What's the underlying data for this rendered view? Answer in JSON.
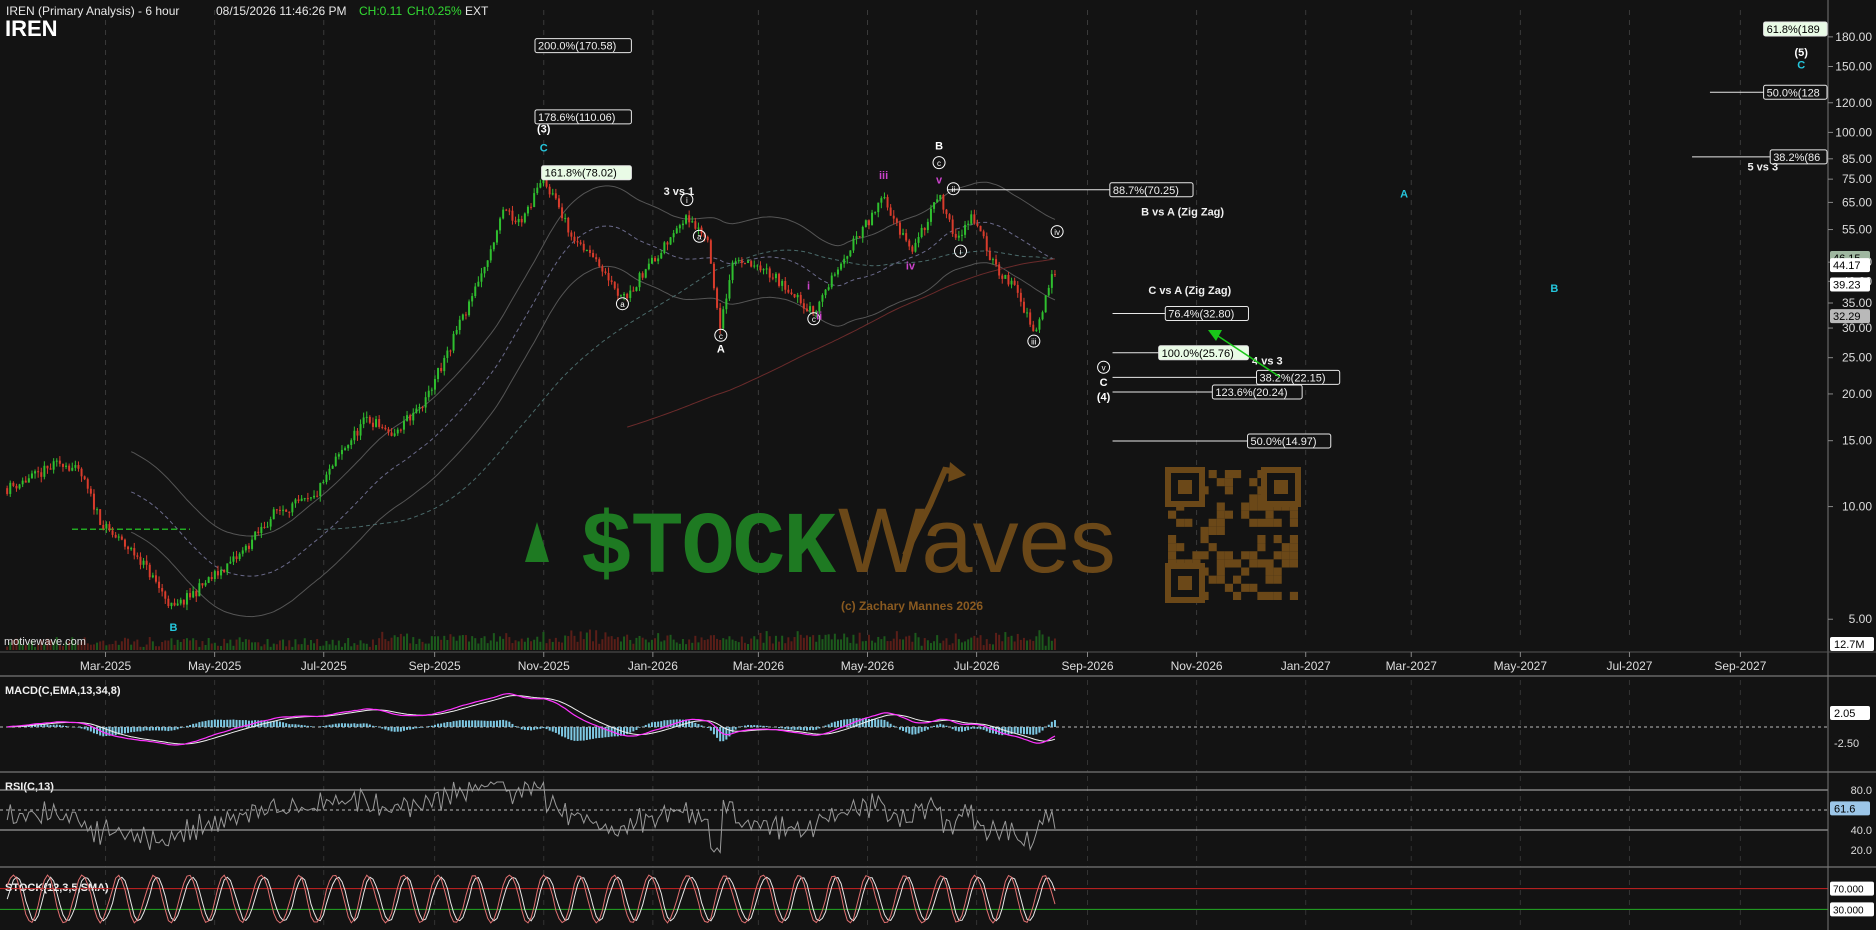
{
  "header": {
    "title": "IREN (Primary Analysis) - 6 hour",
    "timestamp": "08/15/2026 11:46:26 PM",
    "change": "CH:0.11",
    "change_pct": "CH:0.25%",
    "session": "EXT",
    "symbol": "IREN",
    "site": "motivewave.com"
  },
  "watermark": {
    "brand_left": "$TOCK",
    "brand_right": "Waves",
    "copyright": "(c) Zachary Mannes 2026"
  },
  "colors": {
    "background": "#131313",
    "candle_up": "#2fbf2f",
    "candle_down": "#d93c2c",
    "macd_line": "#ff33ff",
    "macd_signal": "#f0f0f0",
    "macd_hist": "#7ec8e3",
    "wave_cyan": "#25c6dc",
    "wave_magenta": "#cc44cc",
    "arrow_green": "#19c619",
    "watermark_green": "#1e7a22",
    "watermark_brown": "#6b4818"
  },
  "chart_data": [
    {
      "type": "candlestick",
      "title": "IREN (Primary Analysis) - 6 hour",
      "x_tick_labels": [
        "Mar-2025",
        "May-2025",
        "Jul-2025",
        "Sep-2025",
        "Nov-2025",
        "Jan-2026",
        "Mar-2026",
        "May-2026",
        "Jul-2026",
        "Sep-2026",
        "Nov-2026",
        "Jan-2027",
        "Mar-2027",
        "May-2027",
        "Jul-2027",
        "Sep-2027"
      ],
      "y_scale": "log",
      "y_tick_labels": [
        "5.00",
        "10.00",
        "15.00",
        "20.00",
        "25.00",
        "30.00",
        "35.00",
        "40.00",
        "45.00",
        "55.00",
        "65.00",
        "75.00",
        "85.00",
        "100.00",
        "120.00",
        "150.00",
        "180.00"
      ],
      "price_tags": [
        {
          "label": "46.15",
          "value": 46.15
        },
        {
          "label": "44.17",
          "value": 44.17
        },
        {
          "label": "39.23",
          "value": 39.23
        },
        {
          "label": "32.29",
          "value": 32.29
        }
      ],
      "volume_tag": "12.7M",
      "price_path": [
        {
          "x": "2025-01-05",
          "y": 11.2
        },
        {
          "x": "2025-01-20",
          "y": 12.0
        },
        {
          "x": "2025-02-05",
          "y": 13.2
        },
        {
          "x": "2025-02-15",
          "y": 12.2
        },
        {
          "x": "2025-02-28",
          "y": 8.8
        },
        {
          "x": "2025-03-20",
          "y": 7.3
        },
        {
          "x": "2025-04-08",
          "y": 5.3
        },
        {
          "x": "2025-04-25",
          "y": 6.2
        },
        {
          "x": "2025-05-15",
          "y": 7.4
        },
        {
          "x": "2025-06-05",
          "y": 9.8
        },
        {
          "x": "2025-06-25",
          "y": 10.4
        },
        {
          "x": "2025-07-10",
          "y": 13.8
        },
        {
          "x": "2025-07-25",
          "y": 17.2
        },
        {
          "x": "2025-08-08",
          "y": 15.8
        },
        {
          "x": "2025-08-25",
          "y": 18.5
        },
        {
          "x": "2025-09-10",
          "y": 27.0
        },
        {
          "x": "2025-09-25",
          "y": 39.0
        },
        {
          "x": "2025-10-10",
          "y": 62.0
        },
        {
          "x": "2025-10-20",
          "y": 58.0
        },
        {
          "x": "2025-11-01",
          "y": 76.0
        },
        {
          "x": "2025-11-15",
          "y": 55.0
        },
        {
          "x": "2025-12-01",
          "y": 44.0
        },
        {
          "x": "2025-12-15",
          "y": 36.0
        },
        {
          "x": "2026-01-01",
          "y": 45.0
        },
        {
          "x": "2026-01-20",
          "y": 60.5
        },
        {
          "x": "2026-02-01",
          "y": 50.0
        },
        {
          "x": "2026-02-08",
          "y": 30.0
        },
        {
          "x": "2026-02-15",
          "y": 47.0
        },
        {
          "x": "2026-03-10",
          "y": 41.0
        },
        {
          "x": "2026-04-01",
          "y": 33.0
        },
        {
          "x": "2026-04-20",
          "y": 48.0
        },
        {
          "x": "2026-05-10",
          "y": 66.0
        },
        {
          "x": "2026-05-25",
          "y": 48.0
        },
        {
          "x": "2026-06-10",
          "y": 67.0
        },
        {
          "x": "2026-06-20",
          "y": 52.0
        },
        {
          "x": "2026-06-28",
          "y": 61.0
        },
        {
          "x": "2026-07-10",
          "y": 45.0
        },
        {
          "x": "2026-07-25",
          "y": 37.0
        },
        {
          "x": "2026-08-02",
          "y": 28.5
        },
        {
          "x": "2026-08-10",
          "y": 38.0
        },
        {
          "x": "2026-08-15",
          "y": 44.6
        }
      ],
      "fib_levels": [
        {
          "label": "200.0%(170.58)",
          "value": 170.58,
          "range": [
            "2025-11-01",
            "2025-12-20"
          ]
        },
        {
          "label": "178.6%(110.06)",
          "value": 110.06,
          "range": [
            "2025-11-01",
            "2025-12-20"
          ]
        },
        {
          "label": "161.8%(78.02)",
          "value": 78.02,
          "range": [
            "2025-11-01",
            "2025-12-20"
          ],
          "highlight": true
        },
        {
          "label": "88.7%(70.25)",
          "value": 70.25,
          "range": [
            "2026-06-15",
            "2026-10-30"
          ]
        },
        {
          "label": "76.4%(32.80)",
          "value": 32.8,
          "range": [
            "2026-09-15",
            "2026-11-30"
          ]
        },
        {
          "label": "100.0%(25.76)",
          "value": 25.76,
          "range": [
            "2026-09-15",
            "2026-11-30"
          ],
          "highlight": true
        },
        {
          "label": "38.2%(22.15)",
          "value": 22.15,
          "range": [
            "2026-09-15",
            "2027-01-20"
          ]
        },
        {
          "label": "123.6%(20.24)",
          "value": 20.24,
          "range": [
            "2026-09-15",
            "2026-12-30"
          ]
        },
        {
          "label": "50.0%(14.97)",
          "value": 14.97,
          "range": [
            "2026-09-15",
            "2027-01-15"
          ]
        },
        {
          "label": "61.8%(189",
          "value": 189,
          "range": [
            "2027-09-15",
            "2027-10-20"
          ],
          "highlight": true
        },
        {
          "label": "50.0%(128",
          "value": 128,
          "range": [
            "2027-08-15",
            "2027-10-20"
          ]
        },
        {
          "label": "38.2%(86",
          "value": 86,
          "range": [
            "2027-08-05",
            "2027-10-20"
          ]
        }
      ],
      "fib_group_labels": [
        {
          "text": "B vs A (Zig Zag)",
          "x": "2026-10-01",
          "y": 60.0
        },
        {
          "text": "C vs A (Zig Zag)",
          "x": "2026-10-05",
          "y": 37.0
        },
        {
          "text": "4 vs 3",
          "x": "2026-12-02",
          "y": 24.0
        },
        {
          "text": "5 vs 3",
          "x": "2027-09-05",
          "y": 79.0
        },
        {
          "text": "3 vs 1",
          "x": "2026-01-07",
          "y": 68.0
        }
      ],
      "wave_labels": [
        {
          "text": "B",
          "color": "cyan",
          "x": "2025-04-08",
          "y": 4.65
        },
        {
          "text": "(3)",
          "color": "white",
          "x": "2025-11-01",
          "y": 100.0
        },
        {
          "text": "C",
          "color": "cyan",
          "x": "2025-11-01",
          "y": 89.0
        },
        {
          "text": "i",
          "color": "white",
          "circle": true,
          "x": "2026-01-20",
          "y": 64.5
        },
        {
          "text": "a",
          "color": "white",
          "circle": true,
          "x": "2026-01-27",
          "y": 51.5
        },
        {
          "text": "a",
          "color": "white",
          "circle": true,
          "x": "2025-12-15",
          "y": 34.0
        },
        {
          "text": "c",
          "color": "white",
          "circle": true,
          "x": "2026-02-08",
          "y": 28.0
        },
        {
          "text": "A",
          "color": "white",
          "x": "2026-02-08",
          "y": 25.8
        },
        {
          "text": "i",
          "color": "magenta",
          "x": "2026-03-29",
          "y": 38.0
        },
        {
          "text": "c",
          "color": "white",
          "circle": true,
          "x": "2026-04-01",
          "y": 31.0
        },
        {
          "text": "ii",
          "color": "magenta",
          "x": "2026-04-04",
          "y": 31.6
        },
        {
          "text": "iii",
          "color": "magenta",
          "x": "2026-05-10",
          "y": 75.0
        },
        {
          "text": "iv",
          "color": "magenta",
          "x": "2026-05-25",
          "y": 43.0
        },
        {
          "text": "B",
          "color": "white",
          "x": "2026-06-10",
          "y": 90.0
        },
        {
          "text": "c",
          "color": "white",
          "circle": true,
          "x": "2026-06-10",
          "y": 81.0
        },
        {
          "text": "v",
          "color": "magenta",
          "x": "2026-06-10",
          "y": 73.0
        },
        {
          "text": "ii",
          "color": "white",
          "circle": true,
          "x": "2026-06-18",
          "y": 69.0
        },
        {
          "text": "i",
          "color": "white",
          "circle": true,
          "x": "2026-06-22",
          "y": 47.0
        },
        {
          "text": "iii",
          "color": "white",
          "circle": true,
          "x": "2026-08-02",
          "y": 27.0
        },
        {
          "text": "iv",
          "color": "white",
          "circle": true,
          "x": "2026-08-15",
          "y": 53.0
        },
        {
          "text": "v",
          "color": "white",
          "circle": true,
          "x": "2026-09-10",
          "y": 23.0
        },
        {
          "text": "C",
          "color": "white",
          "x": "2026-09-10",
          "y": 21.0
        },
        {
          "text": "(4)",
          "color": "white",
          "x": "2026-09-10",
          "y": 19.2
        },
        {
          "text": "A",
          "color": "cyan",
          "x": "2027-02-25",
          "y": 67.0
        },
        {
          "text": "B",
          "color": "cyan",
          "x": "2027-05-20",
          "y": 37.5
        },
        {
          "text": "(5)",
          "color": "white",
          "x": "2027-10-05",
          "y": 160.0
        },
        {
          "text": "C",
          "color": "cyan",
          "x": "2027-10-05",
          "y": 148.0
        }
      ]
    },
    {
      "type": "line",
      "title": "MACD(C,EMA,13,34,8)",
      "y_tick_labels": [
        "2.05",
        "-2.50"
      ],
      "current_value": "2.05",
      "series": []
    },
    {
      "type": "line",
      "title": "RSI(C,13)",
      "y_tick_labels": [
        "80.0",
        "40.0",
        "20.0"
      ],
      "levels": [
        80,
        60,
        40
      ],
      "current_value": "61.6",
      "series": []
    },
    {
      "type": "line",
      "title": "STOCK(12,3,5,SMA)",
      "y_tick_labels": [
        "70.000",
        "30.000"
      ],
      "levels": [
        70,
        30
      ],
      "series": []
    }
  ]
}
